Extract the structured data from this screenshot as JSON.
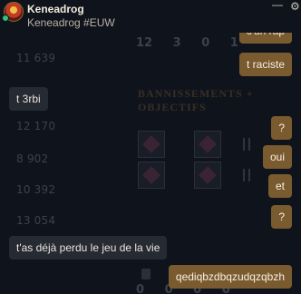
{
  "header": {
    "name": "Keneadrog",
    "riot_id": "Keneadrog #EUW",
    "minimize_glyph": "—",
    "settings_glyph": "⚙"
  },
  "background": {
    "stats": [
      "11 639",
      "12 170",
      "8 902",
      "10 392",
      "13 054"
    ],
    "score_row": "12 3 0 1",
    "zero_row": "0 0 0 0",
    "section_title": [
      "BANNISSEMENTS +",
      "OBJECTIFS"
    ]
  },
  "messages": [
    {
      "from": "me",
      "text": "c'un rap"
    },
    {
      "from": "me",
      "text": "t raciste"
    },
    {
      "from": "them",
      "text": "t 3rbi"
    },
    {
      "from": "me",
      "text": "?"
    },
    {
      "from": "me",
      "text": "oui"
    },
    {
      "from": "me",
      "text": "et"
    },
    {
      "from": "me",
      "text": "?"
    },
    {
      "from": "them",
      "text": "t'as déjà perdu le jeu de la vie"
    },
    {
      "from": "me",
      "text": "qediqbzdbqzudqzqbzh"
    }
  ],
  "colors": {
    "background": "#0f141c",
    "my_bubble": "#7a5a2f",
    "their_bubble": "#252a33",
    "online": "#2ec27e"
  }
}
